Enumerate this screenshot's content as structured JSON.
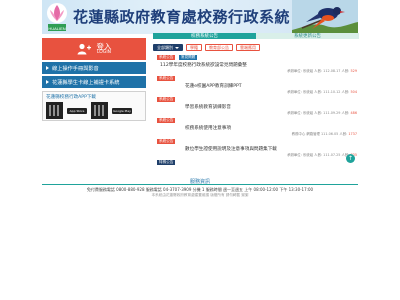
{
  "header": {
    "title": "花蓮縣政府教育處校務行政系統"
  },
  "sidebar": {
    "login_label": "登入",
    "login_sub": "LOGIN",
    "links": [
      "線上操作手冊與影音",
      "花蓮縣學生卡線上補證卡系統"
    ],
    "app_title": "花蓮縣校務行政APP下載",
    "store_labels": [
      "App Store",
      "Google Play"
    ]
  },
  "tabs": [
    "校務系統公告",
    "系統更新公告"
  ],
  "filters": [
    "全部類別",
    "學籍",
    "教育部公告",
    "雲端應用"
  ],
  "announcements": [
    {
      "category": "系統公告",
      "tag": "常見問題",
      "title": "112學年度校務行政系統欲設常見問題彙整",
      "meta": "承辦單位: 系統組 人數: 112.08.17 人數:",
      "views": "529"
    },
    {
      "category": "系統公告",
      "tag": "",
      "title": "花蓮e校園APP教育訓練PPT",
      "meta": "承辦單位: 系統組 人數: 111.10.12 人數:",
      "views": "504"
    },
    {
      "category": "系統公告",
      "tag": "",
      "title": "學習系統教育訓練影音",
      "meta": "承辦單位: 系統組 人數: 111.09.29 人數:",
      "views": "486"
    },
    {
      "category": "系統公告",
      "tag": "",
      "title": "校務系統使用注意事項",
      "meta": "教務中心 網路管理 111.06.05 人數:",
      "views": "1737"
    },
    {
      "category": "系統公告",
      "tag": "",
      "title": "數位學生證使用說明及注意事項與問題集下載",
      "meta": "承辦單位: 系統組 人數: 111.07.25 人數:",
      "views": "835"
    },
    {
      "category": "特殊公告",
      "tag": "",
      "title": "",
      "meta": "",
      "views": ""
    }
  ],
  "footer": {
    "title": "服務資訊",
    "info": "免付費服務電話 0800-880-928 服務電話 04-3707-3909 分機 1 服務時間 週一至週五 上午 08:00-12:00 下午 13:30-17:00",
    "note": "本系統由花蓮縣政府教育處建置維護 版權所有 請勿轉載 謝謝"
  },
  "colors": {
    "accent": "#1fa39b",
    "red": "#e8523f",
    "blue": "#1f72a8"
  }
}
